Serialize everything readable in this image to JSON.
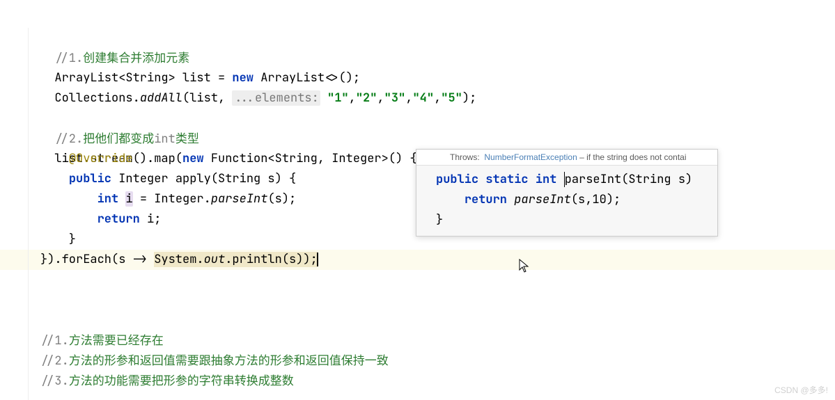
{
  "code": {
    "l1_comment_prefix": "//1.",
    "l1_comment_cn": "创建集合并添加元素",
    "l2_full": "ArrayList<String> list = new ArrayList<>();",
    "l2_p1": "ArrayList<String> list = ",
    "l2_kw": "new",
    "l2_p2": " ArrayList<>();",
    "l3_p1": "Collections.",
    "l3_m": "addAll",
    "l3_p2": "(list, ",
    "l3_hint": "...elements:",
    "l3_s1": "\"1\"",
    "l3_s2": "\"2\"",
    "l3_s3": "\"3\"",
    "l3_s4": "\"4\"",
    "l3_s5": "\"5\"",
    "l3_end": ");",
    "l5_comment_prefix": "//2.",
    "l5_comment_cn1": "把他们都变成",
    "l5_comment_int": "int",
    "l5_comment_cn2": "类型",
    "l6_p1": "list.stream().map(",
    "l6_kw": "new",
    "l6_p2": " Function<String, Integer>() {",
    "l7_ann": "@Override",
    "l8_kw1": "public",
    "l8_p1": " Integer apply(String s) {",
    "l9_kw": "int",
    "l9_var": "i",
    "l9_p1": " = Integer.",
    "l9_m": "parseInt",
    "l9_p2": "(s);",
    "l10_kw": "return",
    "l10_p1": " i;",
    "l11": "    }",
    "l12_p1": "}).forEach(s -> ",
    "l12_sys": "System.",
    "l12_out": "out",
    "l12_p2": ".println(s));",
    "c1_prefix": "//1.",
    "c1_cn": "方法需要已经存在",
    "c2_prefix": "//2.",
    "c2_cn": "方法的形参和返回值需要跟抽象方法的形参和返回值保持一致",
    "c3_prefix": "//3.",
    "c3_cn": "方法的功能需要把形参的字符串转换成整数"
  },
  "tooltip": {
    "throws_label": "Throws:",
    "throws_link": "NumberFormatException",
    "throws_rest": " – if the string does not contai",
    "sig_kw1": "public",
    "sig_kw2": "static",
    "sig_kw3": "int",
    "sig_name": "parseInt",
    "sig_params": "(String s)",
    "ret_kw": "return",
    "ret_call": "parseInt",
    "ret_args": "(s,10);",
    "close": "}"
  },
  "watermark": "CSDN @多多!"
}
